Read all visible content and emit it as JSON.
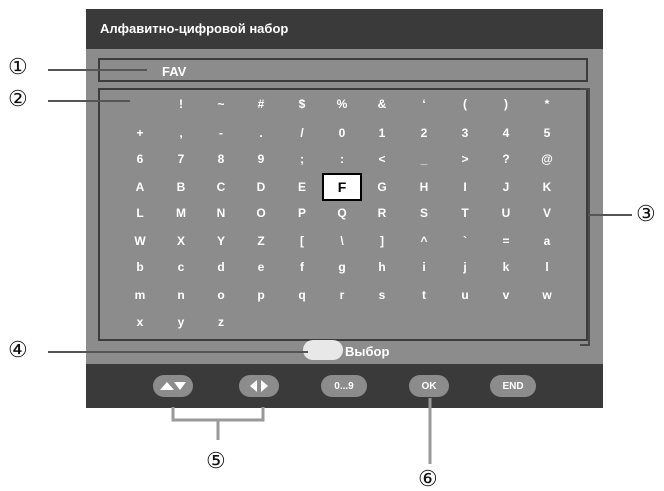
{
  "title": "Алфавитно-цифровой набор",
  "input": {
    "value": "FAV"
  },
  "keyboard": {
    "selected": "F",
    "rows": [
      [
        " ",
        "!",
        "~",
        "#",
        "$",
        "%",
        "&",
        "‘",
        "(",
        ")",
        "*"
      ],
      [
        "+",
        ",",
        "-",
        ".",
        "/",
        "0",
        "1",
        "2",
        "3",
        "4",
        "5"
      ],
      [
        "6",
        "7",
        "8",
        "9",
        ";",
        ":",
        "<",
        "_",
        ">",
        "?",
        "@"
      ],
      [
        "A",
        "B",
        "C",
        "D",
        "E",
        "F",
        "G",
        "H",
        "I",
        "J",
        "K"
      ],
      [
        "L",
        "M",
        "N",
        "O",
        "P",
        "Q",
        "R",
        "S",
        "T",
        "U",
        "V"
      ],
      [
        "W",
        "X",
        "Y",
        "Z",
        "[",
        "\\",
        "]",
        "^",
        "`",
        "=",
        "a"
      ],
      [
        "b",
        "c",
        "d",
        "e",
        "f",
        "g",
        "h",
        "i",
        "j",
        "k",
        "l"
      ],
      [
        "m",
        "n",
        "o",
        "p",
        "q",
        "r",
        "s",
        "t",
        "u",
        "v",
        "w"
      ],
      [
        "x",
        "y",
        "z"
      ]
    ]
  },
  "hint": {
    "label": "Выбор"
  },
  "bottom_bar": {
    "numbers_label": "0...9",
    "ok_label": "OK",
    "end_label": "END"
  },
  "callouts": {
    "c1": "①",
    "c2": "②",
    "c3": "③",
    "c4": "④",
    "c5": "⑤",
    "c6": "⑥"
  }
}
